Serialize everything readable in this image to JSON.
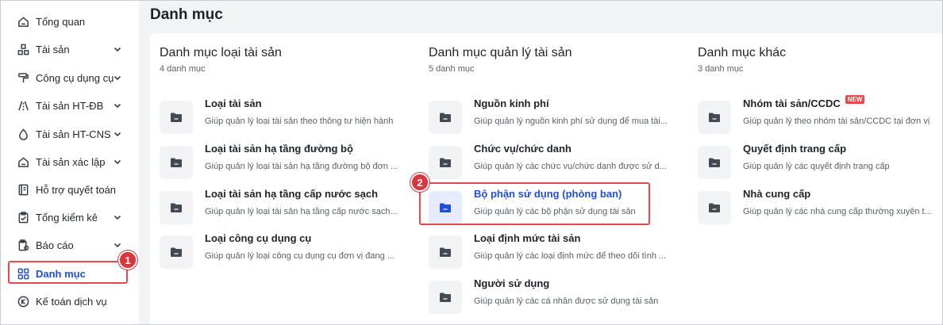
{
  "sidebar": {
    "items": [
      {
        "label": "Tổng quan",
        "icon": "home-icon",
        "has_chevron": false
      },
      {
        "label": "Tài sản",
        "icon": "assets-icon",
        "has_chevron": true
      },
      {
        "label": "Công cụ dụng cụ",
        "icon": "paint-roller-icon",
        "has_chevron": true
      },
      {
        "label": "Tài sản HT-ĐB",
        "icon": "road-icon",
        "has_chevron": true
      },
      {
        "label": "Tài sản HT-CNS",
        "icon": "water-drop-icon",
        "has_chevron": true
      },
      {
        "label": "Tài sản xác lập",
        "icon": "house-icon",
        "has_chevron": true
      },
      {
        "label": "Hỗ trợ quyết toán",
        "icon": "book-icon",
        "has_chevron": false
      },
      {
        "label": "Tổng kiểm kê",
        "icon": "clipboard-icon",
        "has_chevron": true
      },
      {
        "label": "Báo cáo",
        "icon": "report-icon",
        "has_chevron": true
      },
      {
        "label": "Danh mục",
        "icon": "grid-icon",
        "has_chevron": false,
        "active": true
      },
      {
        "label": "Kế toán dịch vụ",
        "icon": "accounting-icon",
        "has_chevron": false
      }
    ]
  },
  "badges": {
    "one": "1",
    "two": "2"
  },
  "page": {
    "title": "Danh mục"
  },
  "columns": [
    {
      "title": "Danh mục loại tài sản",
      "count": "4 danh mục",
      "entries": [
        {
          "title": "Loại tài sản",
          "desc": "Giúp quản lý loại tài sản theo thông tư hiện hành"
        },
        {
          "title": "Loại tài sản hạ tầng đường bộ",
          "desc": "Giúp quản lý loại tài sản hạ tầng đường bộ đơn ..."
        },
        {
          "title": "Loại tài sản hạ tầng cấp nước sạch",
          "desc": "Giúp quản lý loại tài sản hạ tầng cấp nước sạch..."
        },
        {
          "title": "Loại công cụ dụng cụ",
          "desc": "Giúp quản lý loại công cụ dụng cụ đơn vị đang ..."
        }
      ]
    },
    {
      "title": "Danh mục quản lý tài sản",
      "count": "5 danh mục",
      "entries": [
        {
          "title": "Nguồn kinh phí",
          "desc": "Giúp quản lý nguồn kinh phí sử dụng để mua tài..."
        },
        {
          "title": "Chức vụ/chức danh",
          "desc": "Giúp quản lý các chức vụ/chức danh được sử d..."
        },
        {
          "title": "Bộ phận sử dụng (phòng ban)",
          "desc": "Giúp quản lý các bộ phận sử dụng tài sản"
        },
        {
          "title": "Loại định mức tài sản",
          "desc": "Giúp quản lý các loại định mức để theo dõi tình ..."
        },
        {
          "title": "Người sử dụng",
          "desc": "Giúp quản lý các cá nhân được sử dụng tài sản"
        }
      ]
    },
    {
      "title": "Danh mục khác",
      "count": "3 danh mục",
      "entries": [
        {
          "title": "Nhóm tài sản/CCDC",
          "desc": "Giúp quản lý theo nhóm tài sản/CCDC tại đơn vị",
          "tag": "NEW"
        },
        {
          "title": "Quyết định trang cấp",
          "desc": "Giúp quản lý các quyết định trang cấp"
        },
        {
          "title": "Nhà cung cấp",
          "desc": "Giúp quản lý các nhà cung cấp thường xuyên t..."
        }
      ]
    }
  ],
  "colors": {
    "accent": "#1f4fd8",
    "highlight": "#e5484d",
    "badge": "#d9363e"
  }
}
